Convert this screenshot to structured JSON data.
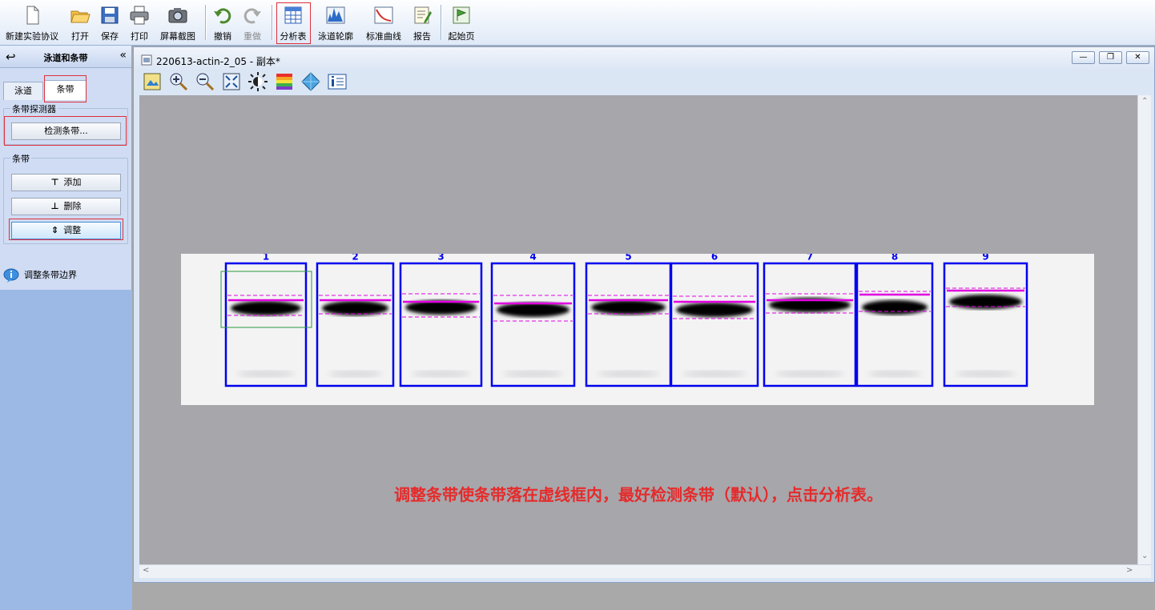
{
  "toolbar": {
    "items": [
      {
        "label": "新建实验协议",
        "icon": "new-document-icon"
      },
      {
        "label": "打开",
        "icon": "open-folder-icon"
      },
      {
        "label": "保存",
        "icon": "save-icon"
      },
      {
        "label": "打印",
        "icon": "print-icon"
      },
      {
        "label": "屏幕截图",
        "icon": "camera-icon"
      },
      {
        "label": "撤销",
        "icon": "undo-icon"
      },
      {
        "label": "重做",
        "icon": "redo-icon"
      },
      {
        "label": "分析表",
        "icon": "analysis-table-icon"
      },
      {
        "label": "泳道轮廓",
        "icon": "lane-profile-icon"
      },
      {
        "label": "标准曲线",
        "icon": "standard-curve-icon"
      },
      {
        "label": "报告",
        "icon": "report-icon"
      },
      {
        "label": "起始页",
        "icon": "start-page-icon"
      }
    ]
  },
  "left_panel": {
    "title": "泳道和条带",
    "back_icon": "back-arrow-icon",
    "collapse_icon": "double-chevron-left-icon",
    "tabs": [
      "泳道",
      "条带"
    ],
    "active_tab": "条带",
    "detector_group": {
      "title": "条带探测器",
      "detect_button": "检测条带..."
    },
    "bands_group": {
      "title": "条带",
      "add": "添加",
      "delete": "删除",
      "adjust": "调整"
    },
    "hint": "调整条带边界"
  },
  "document": {
    "title": "220613-actin-2_05 - 副本*",
    "window_buttons": [
      "minimize",
      "restore",
      "close"
    ],
    "tools": [
      "image-properties-icon",
      "zoom-in-icon",
      "zoom-out-icon",
      "fit-to-window-icon",
      "brightness-icon",
      "color-palette-icon",
      "3d-view-icon",
      "info-icon"
    ],
    "lanes": [
      "1",
      "2",
      "3",
      "4",
      "5",
      "6",
      "7",
      "8",
      "9"
    ],
    "instruction": "调整条带使条带落在虚线框内，最好检测条带（默认），点击分析表。"
  },
  "colors": {
    "lane_box": "#0000ee",
    "band_line": "#e000e0",
    "instruction": "#e52b2b",
    "highlight": "#e0303a"
  }
}
